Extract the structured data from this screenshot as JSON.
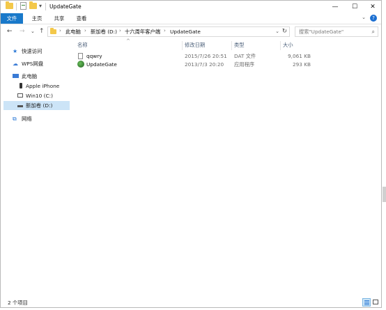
{
  "window": {
    "title": "UpdateGate",
    "controls": {
      "minimize": "—",
      "maximize": "☐",
      "close": "✕"
    },
    "quick_access_dropdown": "▾"
  },
  "ribbon": {
    "tabs": [
      {
        "label": "文件",
        "active": true
      },
      {
        "label": "主页",
        "active": false
      },
      {
        "label": "共享",
        "active": false
      },
      {
        "label": "查看",
        "active": false
      }
    ],
    "expand": "⌄",
    "help": "?"
  },
  "navigation": {
    "back": "←",
    "forward": "→",
    "recent": "⌄",
    "up": "↑",
    "breadcrumb": [
      "此电脑",
      "新加卷 (D:)",
      "十六周年客户端",
      "UpdateGate"
    ],
    "separator": "›",
    "dropdown": "⌄",
    "refresh": "↻"
  },
  "search": {
    "placeholder": "搜索\"UpdateGate\"",
    "icon": "⌕"
  },
  "sidebar": {
    "items": [
      {
        "label": "快速访问",
        "icon": "star-icon",
        "glyph": "★",
        "color": "#2b79d6"
      },
      {
        "label": "WPS网盘",
        "icon": "cloud-icon",
        "glyph": "☁",
        "color": "#3a7bd5"
      },
      {
        "label": "此电脑",
        "icon": "computer-icon",
        "glyph": "🖥",
        "color": "#3a7bd5"
      },
      {
        "label": "Apple iPhone",
        "icon": "phone-icon",
        "glyph": "▮",
        "color": "#333333"
      },
      {
        "label": "Win10 (C:)",
        "icon": "drive-c-icon",
        "glyph": "▭",
        "color": "#555555"
      },
      {
        "label": "新加卷 (D:)",
        "icon": "drive-d-icon",
        "glyph": "▬",
        "color": "#555555",
        "selected": true
      },
      {
        "label": "网络",
        "icon": "network-icon",
        "glyph": "⧉",
        "color": "#2b79d6"
      }
    ]
  },
  "file_list": {
    "columns": [
      "名称",
      "修改日期",
      "类型",
      "大小"
    ],
    "sort_indicator": "^",
    "rows": [
      {
        "name": "qqwry",
        "modified": "2015/7/26 20:51",
        "type": "DAT 文件",
        "size": "9,061 KB",
        "icon": "document-icon"
      },
      {
        "name": "UpdateGate",
        "modified": "2013/7/3 20:20",
        "type": "应用程序",
        "size": "293 KB",
        "icon": "application-icon"
      }
    ]
  },
  "status": {
    "item_count": "2 个项目"
  },
  "colors": {
    "accent": "#1979ca",
    "selected_bg": "#cce4f7",
    "folder": "#f3c84a"
  }
}
